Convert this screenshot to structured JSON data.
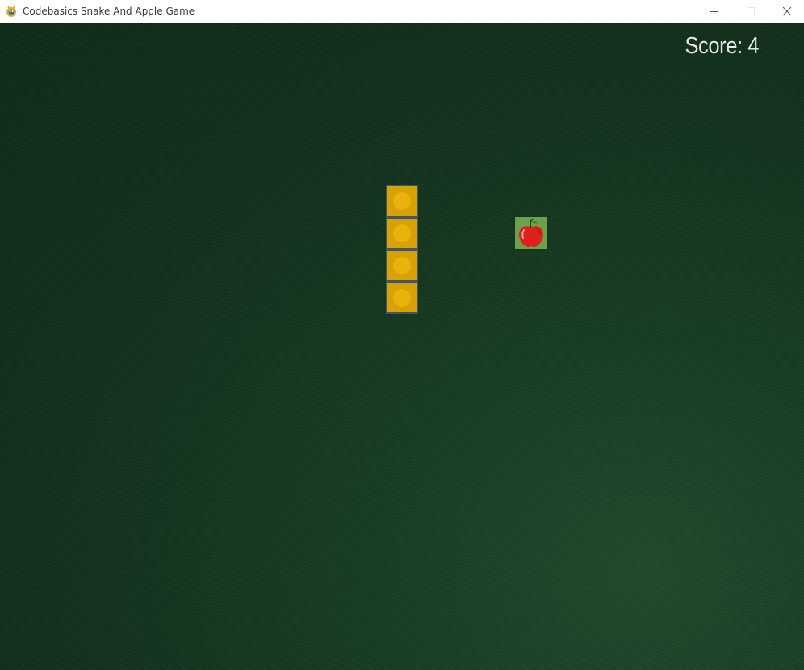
{
  "window": {
    "title": "Codebasics Snake And Apple Game",
    "icon": "pygame-snake-icon",
    "controls": {
      "minimize_icon": "minimize-icon",
      "maximize_icon": "maximize-icon",
      "close_icon": "close-icon"
    }
  },
  "game": {
    "score_text": "Score: 4",
    "score": 4,
    "background_color": "#163820",
    "snake": {
      "length": 4,
      "segment_color": "#d7a206",
      "segment_border_color": "#3b5470"
    },
    "apple": {
      "icon": "apple-icon",
      "tile_color": "#6aa14a",
      "fruit_color": "#e0201c"
    }
  }
}
